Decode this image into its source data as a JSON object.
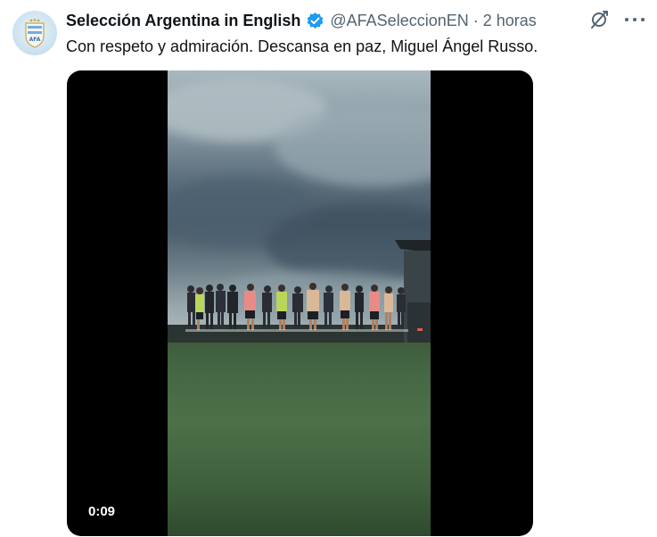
{
  "tweet": {
    "display_name": "Selección Argentina in English",
    "handle": "@AFASeleccionEN",
    "separator": "·",
    "time": "2 horas",
    "text": "Con respeto y admiración. Descansa en paz, Miguel Ángel Russo.",
    "avatar_icon": "afa-crest-icon",
    "verified_icon": "verified-badge-icon",
    "verified_color": "#1d9bf0"
  },
  "media": {
    "type": "video",
    "duration": "0:09"
  },
  "actions": {
    "grok_icon": "grok-icon",
    "more_icon": "more-options-icon"
  }
}
